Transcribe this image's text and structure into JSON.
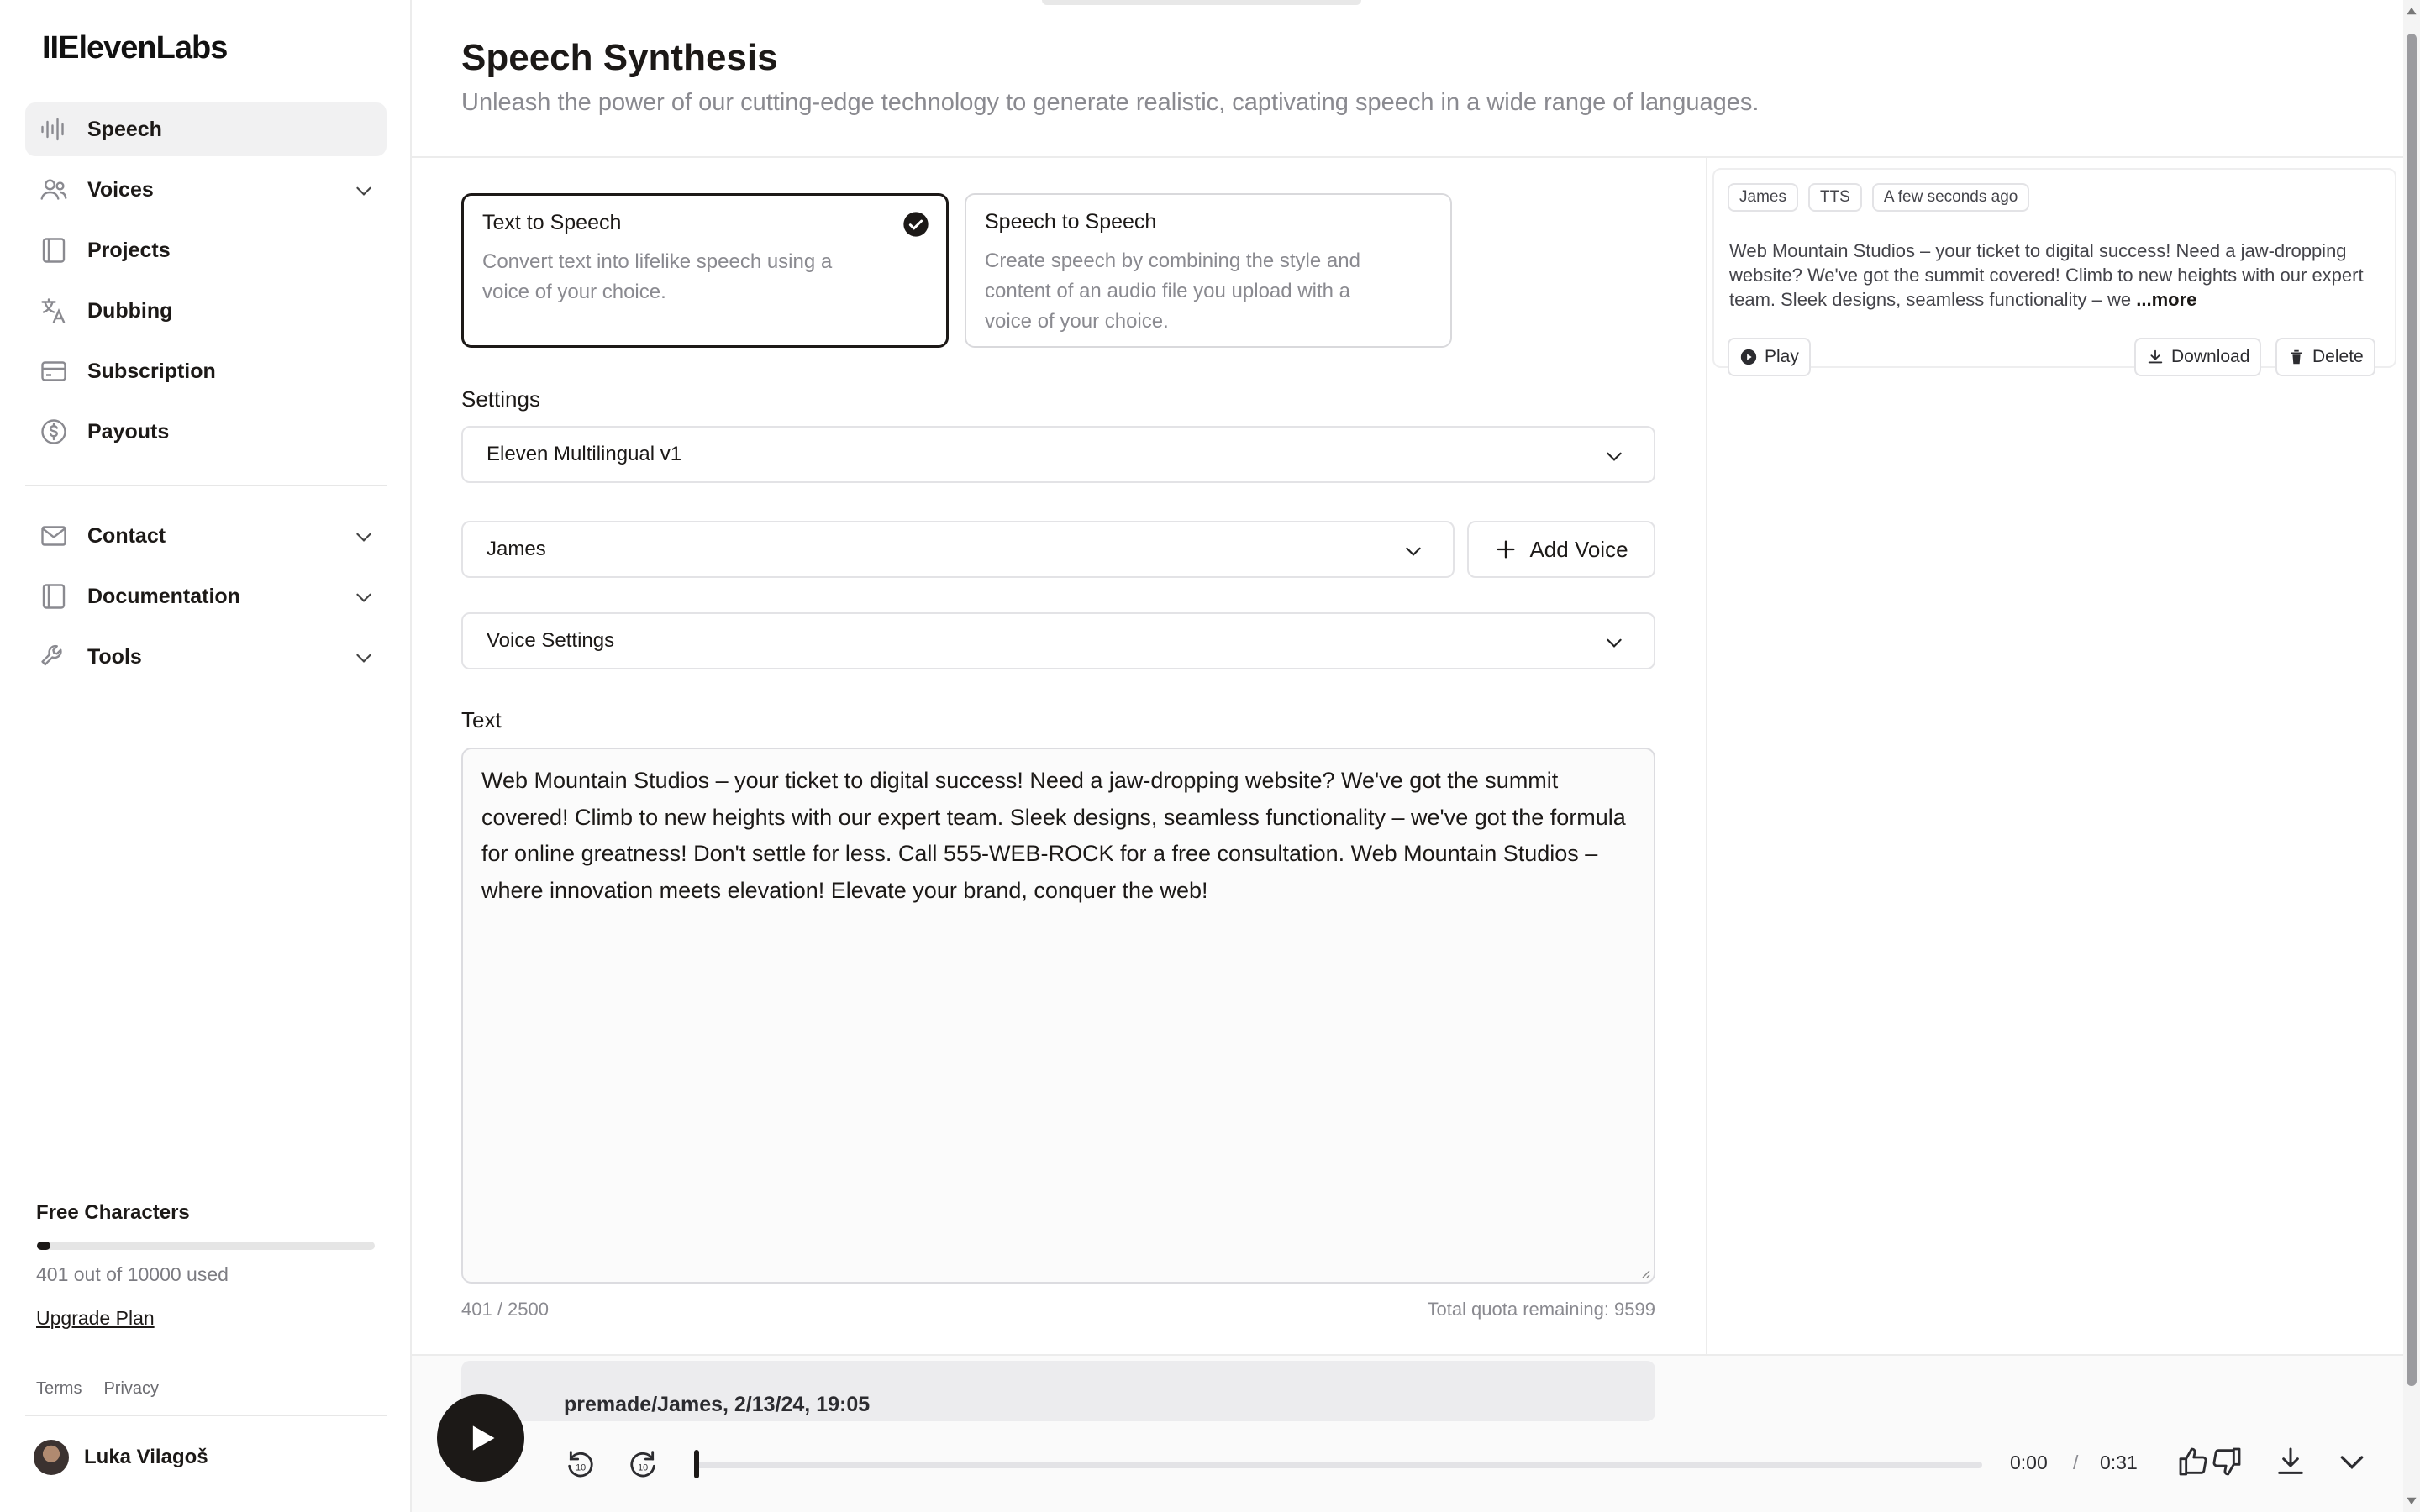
{
  "app": {
    "logo": "IIElevenLabs"
  },
  "sidebar": {
    "items": [
      {
        "label": "Speech",
        "icon": "waveform-icon",
        "active": true
      },
      {
        "label": "Voices",
        "icon": "users-icon",
        "expandable": true
      },
      {
        "label": "Projects",
        "icon": "book-icon"
      },
      {
        "label": "Dubbing",
        "icon": "translate-icon"
      },
      {
        "label": "Subscription",
        "icon": "credit-card-icon"
      },
      {
        "label": "Payouts",
        "icon": "dollar-coin-icon"
      }
    ],
    "secondary_items": [
      {
        "label": "Contact",
        "icon": "mail-icon",
        "expandable": true
      },
      {
        "label": "Documentation",
        "icon": "book-icon",
        "expandable": true
      },
      {
        "label": "Tools",
        "icon": "wrench-icon",
        "expandable": true
      }
    ],
    "quota": {
      "title": "Free Characters",
      "used_fraction": 0.0401,
      "text": "401 out of 10000 used",
      "upgrade_label": "Upgrade Plan"
    },
    "footer": {
      "terms": "Terms",
      "privacy": "Privacy"
    },
    "user": {
      "name": "Luka Vilagoš"
    }
  },
  "header": {
    "title": "Speech Synthesis",
    "subtitle": "Unleash the power of our cutting-edge technology to generate realistic, captivating speech in a wide range of languages."
  },
  "modes": [
    {
      "title": "Text to Speech",
      "description": "Convert text into lifelike speech using a voice of your choice.",
      "selected": true
    },
    {
      "title": "Speech to Speech",
      "description": "Create speech by combining the style and content of an audio file you upload with a voice of your choice.",
      "selected": false
    }
  ],
  "settings": {
    "label": "Settings",
    "model": "Eleven Multilingual v1",
    "voice": "James",
    "add_voice_label": "Add Voice",
    "voice_settings_label": "Voice Settings"
  },
  "text": {
    "label": "Text",
    "value": "Web Mountain Studios – your ticket to digital success! Need a jaw-dropping website? We've got the summit covered! Climb to new heights with our expert team.  Sleek designs, seamless functionality – we've got the formula for online greatness! Don't settle for less. Call 555-WEB-ROCK for a free consultation. Web Mountain Studios – where innovation meets elevation! Elevate your brand, conquer the web!",
    "char_count": "401 / 2500",
    "quota_remaining": "Total quota remaining: 9599"
  },
  "history": {
    "badges": [
      "James",
      "TTS",
      "A few seconds ago"
    ],
    "text": "Web Mountain Studios – your ticket to digital success! Need a jaw-dropping website? We've got the summit covered! Climb to new heights with our expert team. Sleek designs, seamless functionality – we ",
    "more_label": "...more",
    "play_label": "Play",
    "download_label": "Download",
    "delete_label": "Delete"
  },
  "player": {
    "title": "premade/James, 2/13/24, 19:05",
    "current_time": "0:00",
    "separator": "/",
    "duration": "0:31",
    "progress_fraction": 0.0
  },
  "colors": {
    "accent": "#1c1917",
    "muted_text": "#8a8a90",
    "border": "#e3e3e6",
    "spell_error": "#e03131"
  }
}
